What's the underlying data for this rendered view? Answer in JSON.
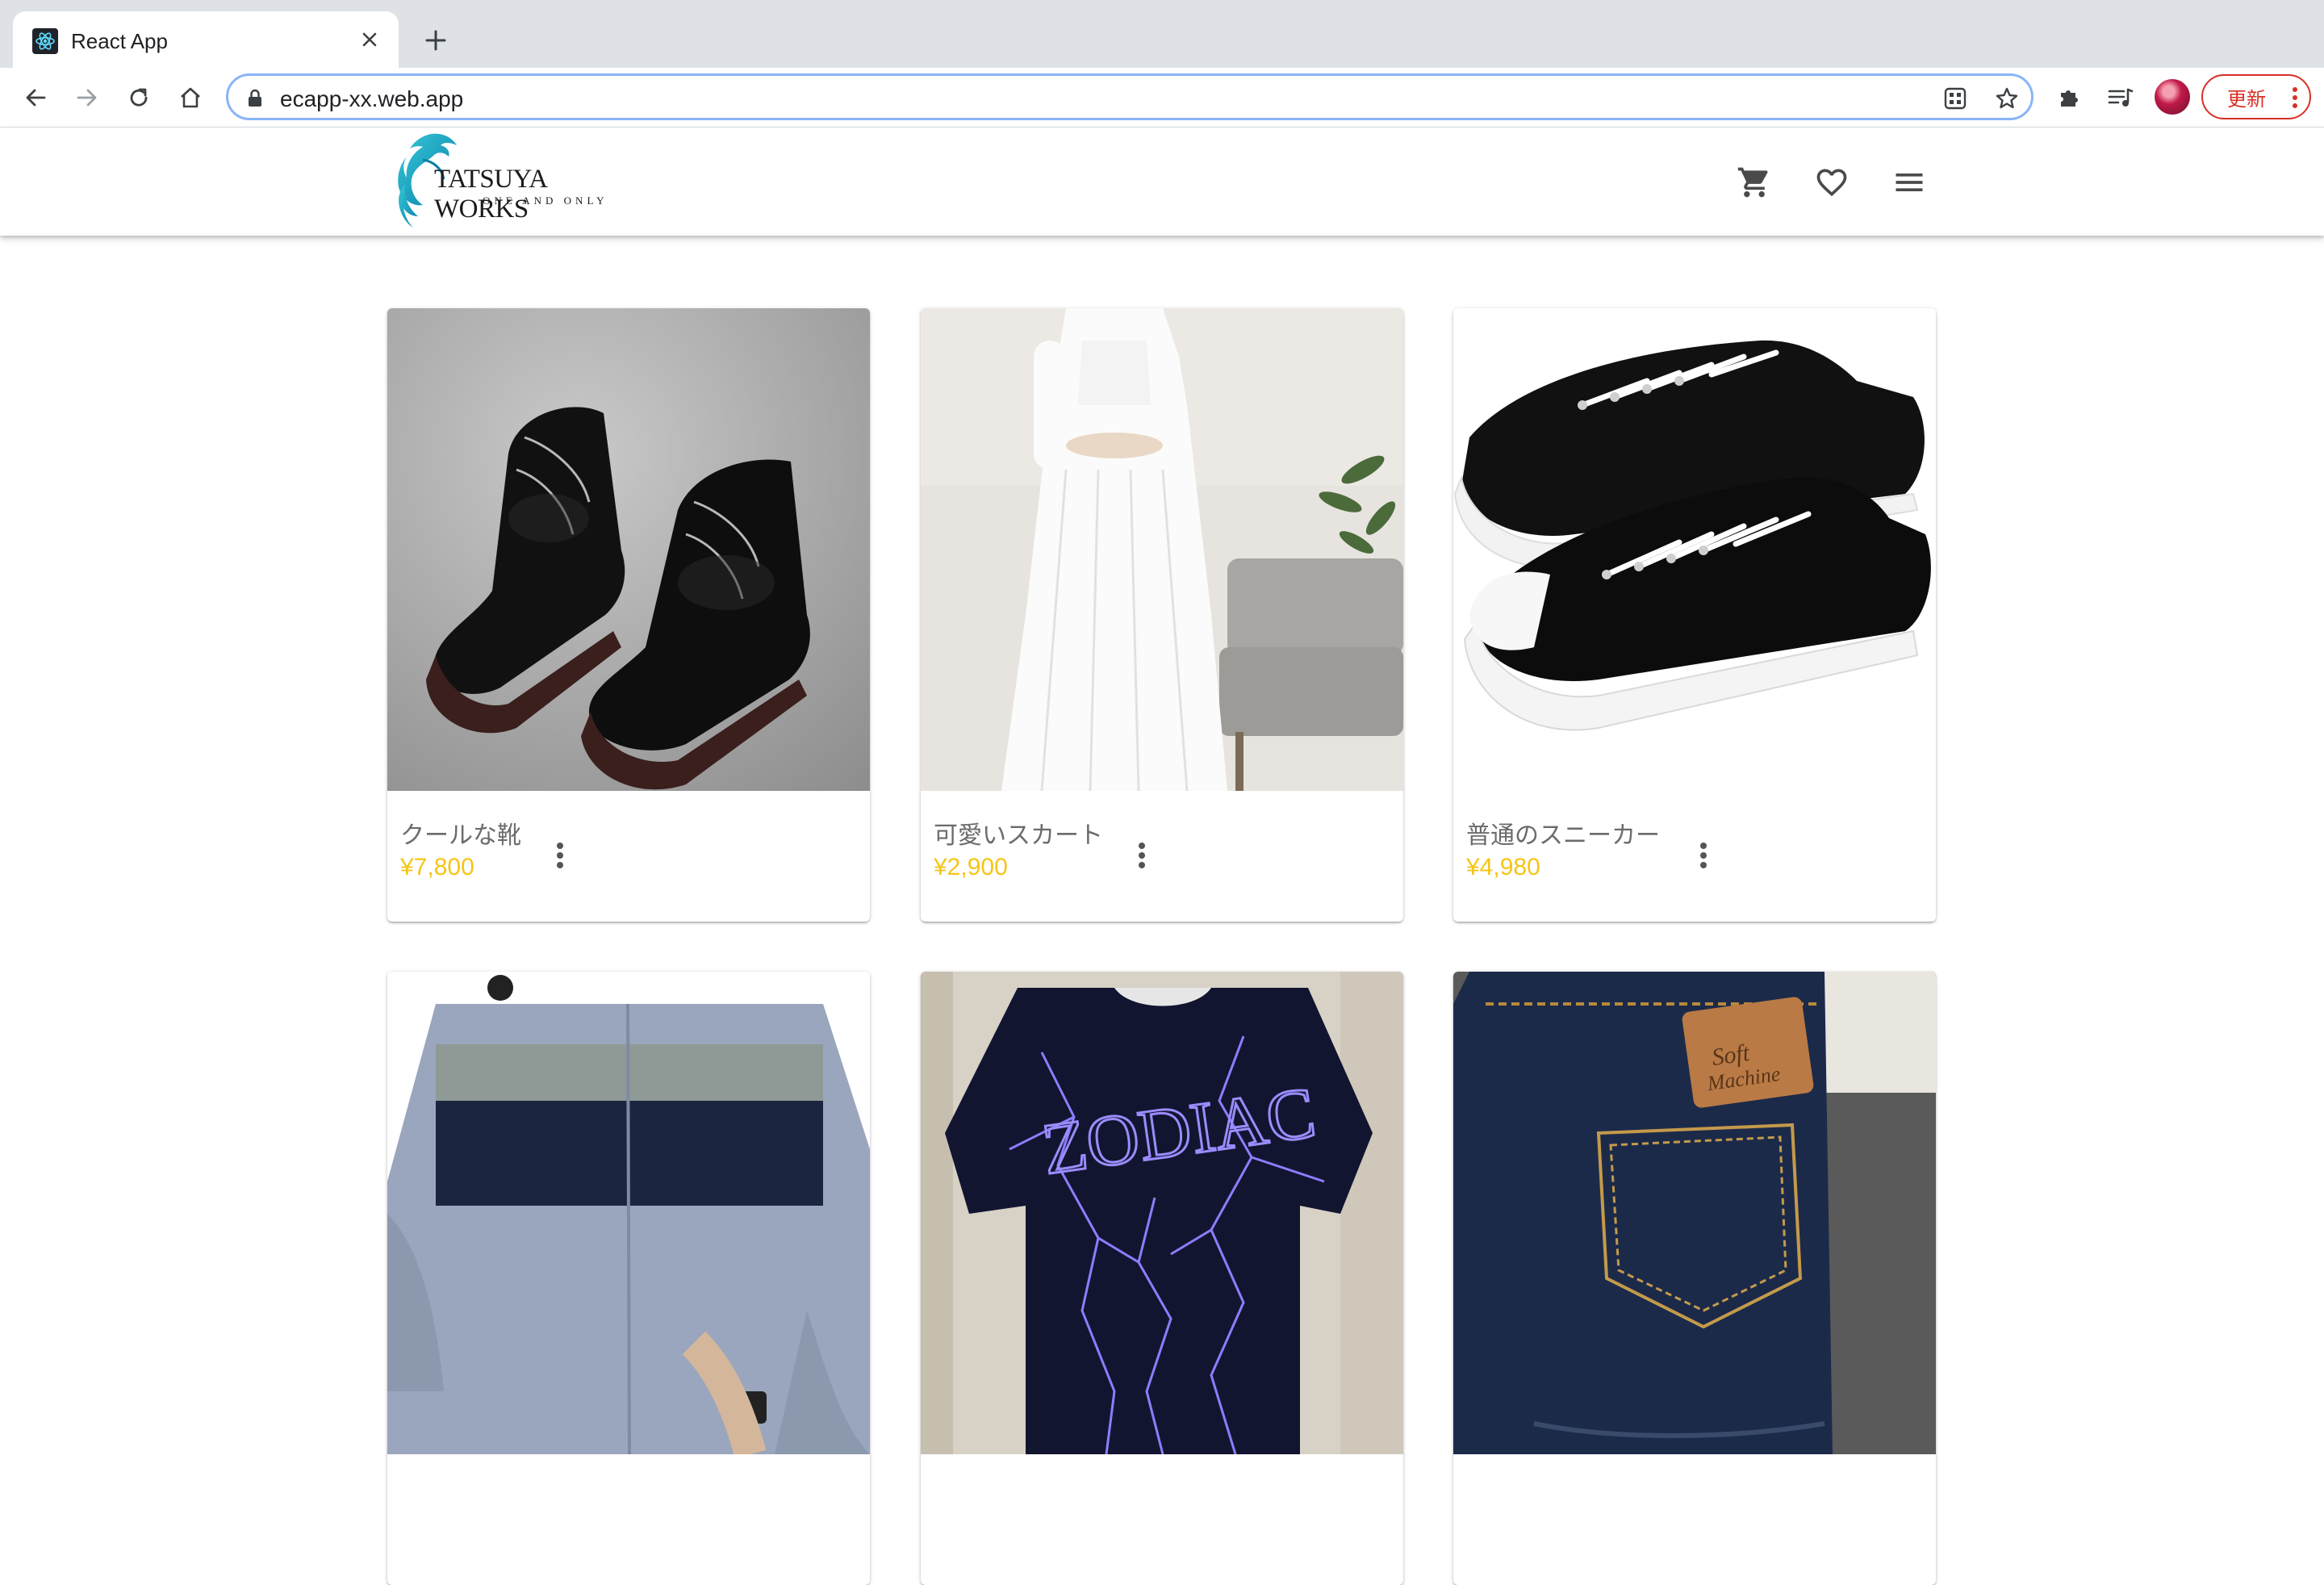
{
  "browser": {
    "tab_title": "React App",
    "url": "ecapp-xx.web.app",
    "update_label": "更新"
  },
  "header": {
    "logo_main": "TATSUYA WORKS",
    "logo_sub": "ONE AND ONLY",
    "icons": [
      "cart-icon",
      "favorite-icon",
      "menu-icon"
    ]
  },
  "products": [
    {
      "name": "クールな靴",
      "price": "¥7,800",
      "image": "black leather lace-up boots"
    },
    {
      "name": "可愛いスカート",
      "price": "¥2,900",
      "image": "white dress"
    },
    {
      "name": "普通のスニーカー",
      "price": "¥4,980",
      "image": "black canvas sneakers"
    },
    {
      "name": "",
      "price": "",
      "image": "blue striped shirt"
    },
    {
      "name": "",
      "price": "",
      "image": "lightning print t-shirt"
    },
    {
      "name": "",
      "price": "",
      "image": "denim jeans"
    }
  ],
  "colors": {
    "price": "#f5c518",
    "chrome_tabstrip": "#dee1e6",
    "update_red": "#d93025"
  }
}
